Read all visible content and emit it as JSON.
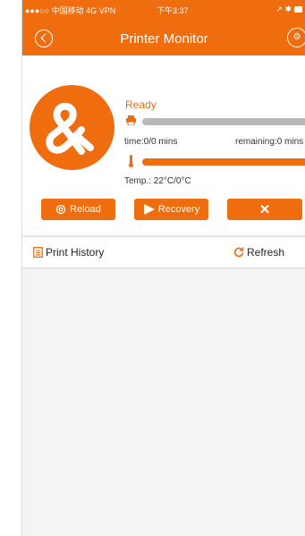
{
  "status_bar": {
    "carrier": "●●●○○ 中国移动 4G VPN",
    "time": "下午3:37",
    "indicators": "↗ ✱"
  },
  "header": {
    "title": "Printer Monitor",
    "back_icon": "back-circle-icon",
    "settings_icon": "settings-circle-icon"
  },
  "printer": {
    "state": "Ready",
    "time_text": "time:0/0 mins",
    "remaining_text": "remaining:0 mins",
    "temp_text": "Temp.: 22°C/0°C",
    "progress_fraction": 0,
    "temperature_fill_fraction": 1
  },
  "actions": {
    "reload_label": "Reload",
    "recovery_label": "Recovery",
    "cancel_label": "✕"
  },
  "history": {
    "label": "Print History",
    "refresh_label": "Refresh"
  },
  "colors": {
    "accent": "#ef6c0f",
    "bar_grey": "#b8b8b8"
  }
}
